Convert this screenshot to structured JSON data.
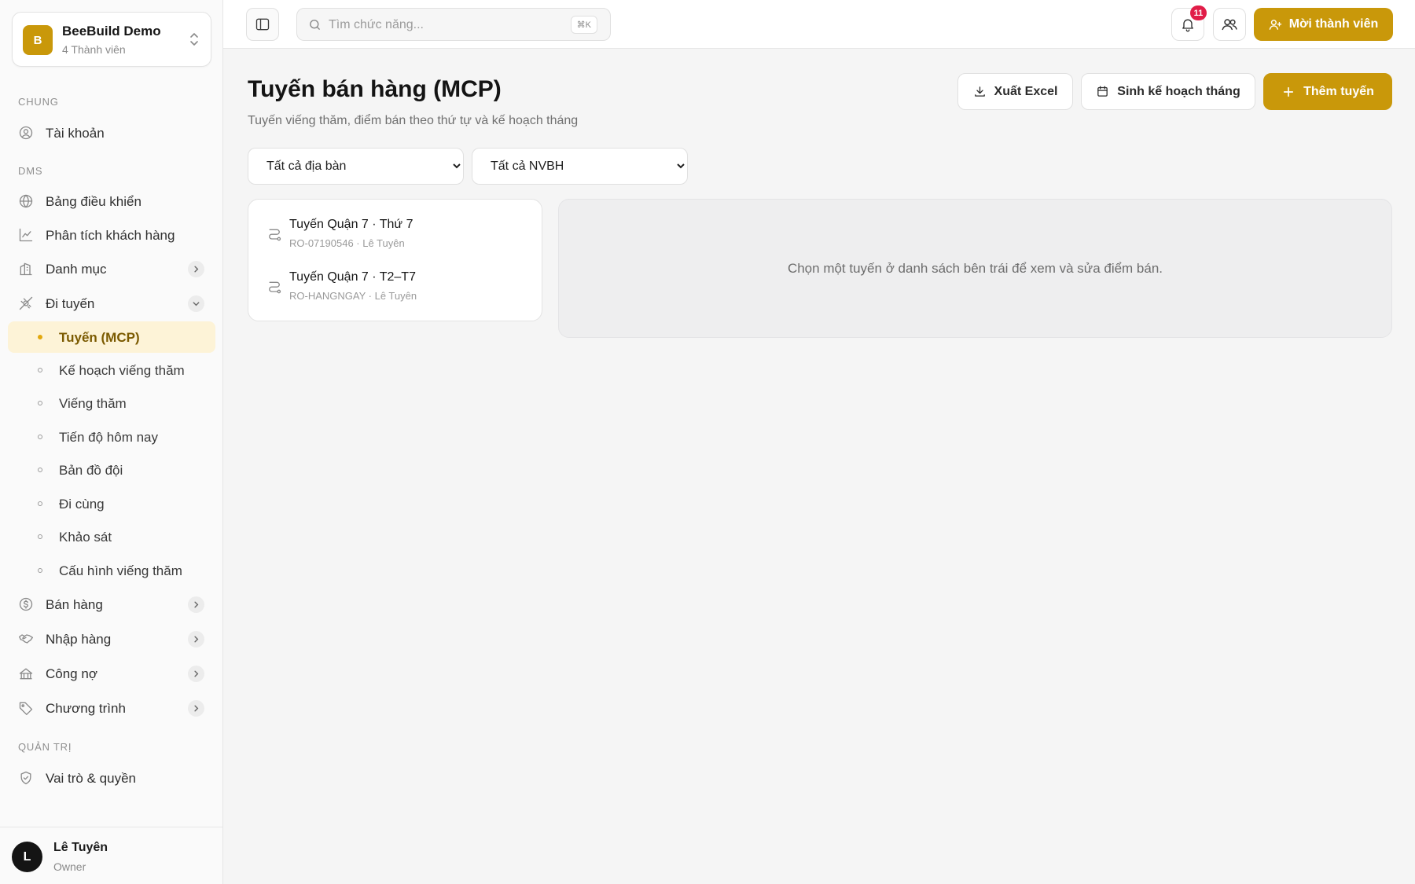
{
  "workspace": {
    "initial": "B",
    "name": "BeeBuild Demo",
    "members": "4 Thành viên"
  },
  "sidebar": {
    "sections": {
      "general": "CHUNG",
      "dms": "DMS",
      "admin": "QUẢN TRỊ"
    },
    "account": "Tài khoản",
    "dashboard": "Bảng điều khiển",
    "customer_analysis": "Phân tích khách hàng",
    "catalog": "Danh mục",
    "routing": "Đi tuyến",
    "routing_sub": [
      "Tuyến (MCP)",
      "Kế hoạch viếng thăm",
      "Viếng thăm",
      "Tiến độ hôm nay",
      "Bản đồ đội",
      "Đi cùng",
      "Khảo sát",
      "Cấu hình viếng thăm"
    ],
    "sales": "Bán hàng",
    "purchasing": "Nhập hàng",
    "debt": "Công nợ",
    "programs": "Chương trình",
    "roles": "Vai trò & quyền"
  },
  "user": {
    "initial": "L",
    "name": "Lê Tuyên",
    "role": "Owner"
  },
  "topbar": {
    "search_placeholder": "Tìm chức năng...",
    "shortcut": "⌘K",
    "notifications": "11",
    "invite_label": "Mời thành viên"
  },
  "page": {
    "title": "Tuyến bán hàng (MCP)",
    "subtitle": "Tuyến viếng thăm, điểm bán theo thứ tự và kế hoạch tháng",
    "export_label": "Xuất Excel",
    "plan_label": "Sinh kế hoạch tháng",
    "add_label": "Thêm tuyến",
    "filter_area": "Tất cả địa bàn",
    "filter_staff": "Tất cả NVBH",
    "routes": [
      {
        "name": "Tuyến Quận 7 · Thứ 7",
        "meta": "RO-07190546 · Lê Tuyên"
      },
      {
        "name": "Tuyến Quận 7 · T2–T7",
        "meta": "RO-HANGNGAY · Lê Tuyên"
      }
    ],
    "empty_message": "Chọn một tuyến ở danh sách bên trái để xem và sửa điểm bán."
  },
  "colors": {
    "accent": "#c9980a",
    "active_bg": "#fdf3d7",
    "badge": "#e11d48"
  }
}
